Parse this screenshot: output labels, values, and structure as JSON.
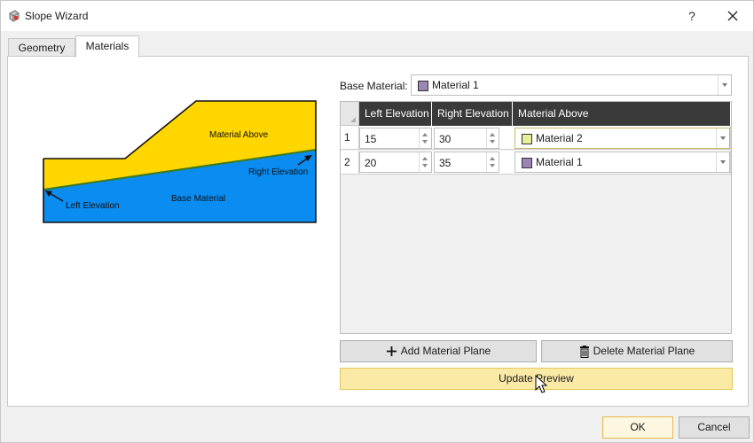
{
  "window": {
    "title": "Slope Wizard",
    "help_label": "?"
  },
  "tabs": [
    {
      "label": "Geometry",
      "selected": false
    },
    {
      "label": "Materials",
      "selected": true
    }
  ],
  "preview": {
    "labels": {
      "material_above": "Material Above",
      "right_elevation": "Right Elevation",
      "base_material": "Base Material",
      "left_elevation": "Left Elevation"
    },
    "colors": {
      "material_above": "#FFD600",
      "base_material": "#0A8CF0",
      "plane_line": "#3C7A1E"
    }
  },
  "base_material": {
    "label": "Base Material:",
    "value": "Material 1",
    "swatch_color": "#9B85B5"
  },
  "table": {
    "columns": [
      "Left Elevation",
      "Right Elevation",
      "Material Above"
    ],
    "rows": [
      {
        "num": "1",
        "left": "15",
        "right": "30",
        "material": "Material 2",
        "swatch_color": "#E6EF9A"
      },
      {
        "num": "2",
        "left": "20",
        "right": "35",
        "material": "Material 1",
        "swatch_color": "#9B85B5"
      }
    ]
  },
  "buttons": {
    "add": "Add Material Plane",
    "delete": "Delete Material Plane",
    "update": "Update Preview",
    "ok": "OK",
    "cancel": "Cancel"
  }
}
